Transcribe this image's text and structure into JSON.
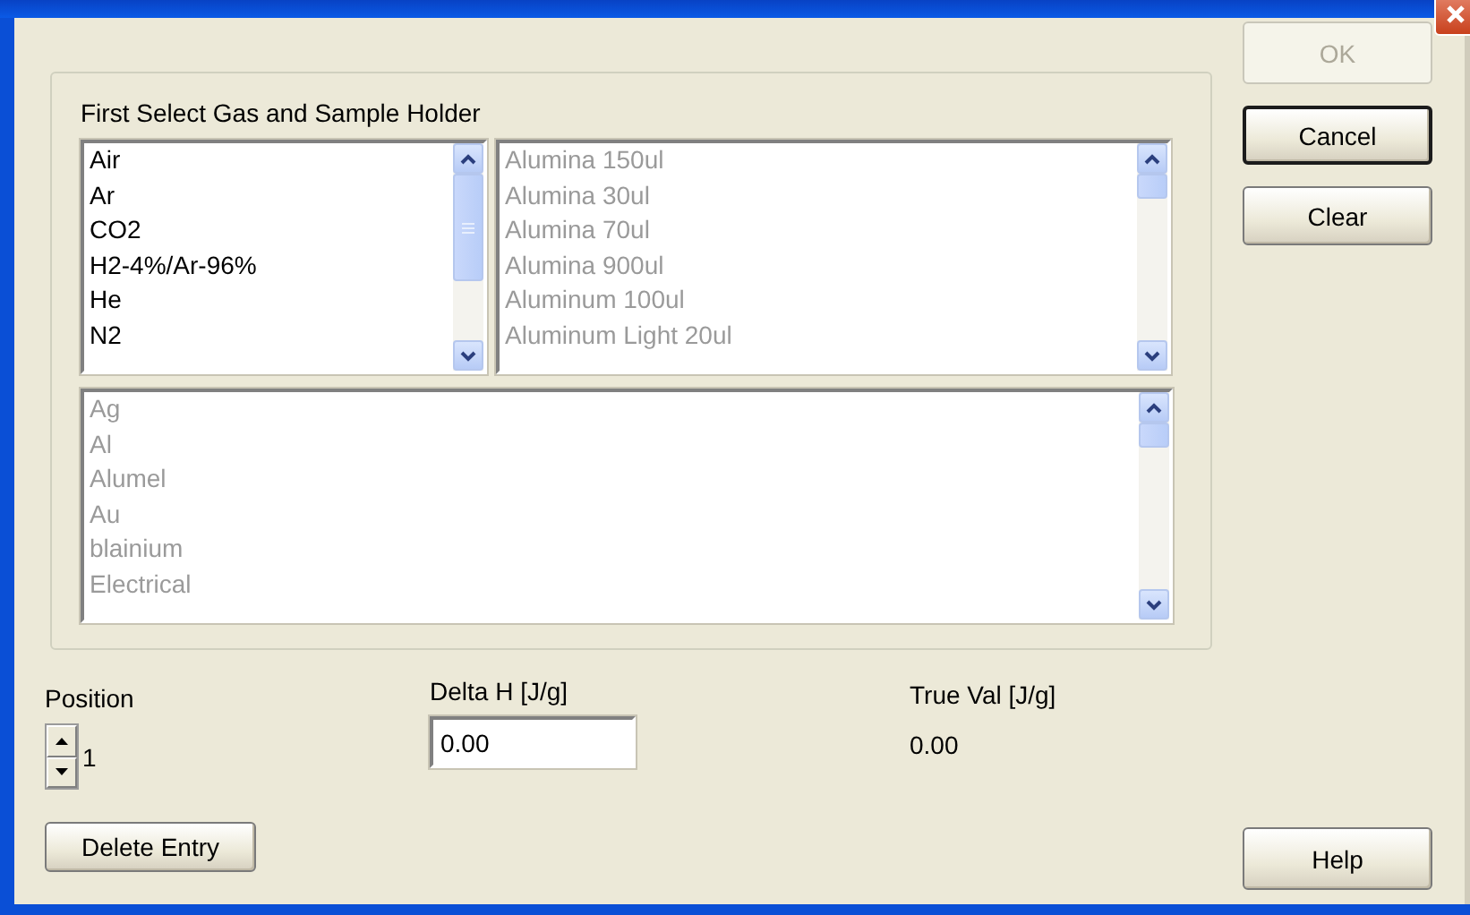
{
  "dialog": {
    "group_label": "First Select Gas and Sample Holder",
    "gas_list": {
      "disabled": false,
      "items": [
        "Air",
        "Ar",
        "CO2",
        "H2-4%/Ar-96%",
        "He",
        "N2"
      ]
    },
    "holder_list": {
      "disabled": true,
      "items": [
        "Alumina 150ul",
        "Alumina 30ul",
        "Alumina 70ul",
        "Alumina 900ul",
        "Aluminum 100ul",
        "Aluminum Light 20ul"
      ]
    },
    "material_list": {
      "disabled": true,
      "items": [
        "Ag",
        "Al",
        "Alumel",
        "Au",
        "blainium",
        "Electrical"
      ]
    },
    "position": {
      "label": "Position",
      "value": "1"
    },
    "delete_button": {
      "label": "Delete Entry"
    },
    "delta_h": {
      "label": "Delta H [J/g]",
      "value": "0.00"
    },
    "true_val": {
      "label": "True Val [J/g]",
      "value": "0.00"
    }
  },
  "side_buttons": [
    {
      "label": "OK",
      "disabled": true,
      "default": false
    },
    {
      "label": "Cancel",
      "disabled": false,
      "default": true
    },
    {
      "label": "Clear",
      "disabled": false,
      "default": false
    }
  ],
  "help_button": {
    "label": "Help",
    "disabled": false,
    "default": false
  }
}
